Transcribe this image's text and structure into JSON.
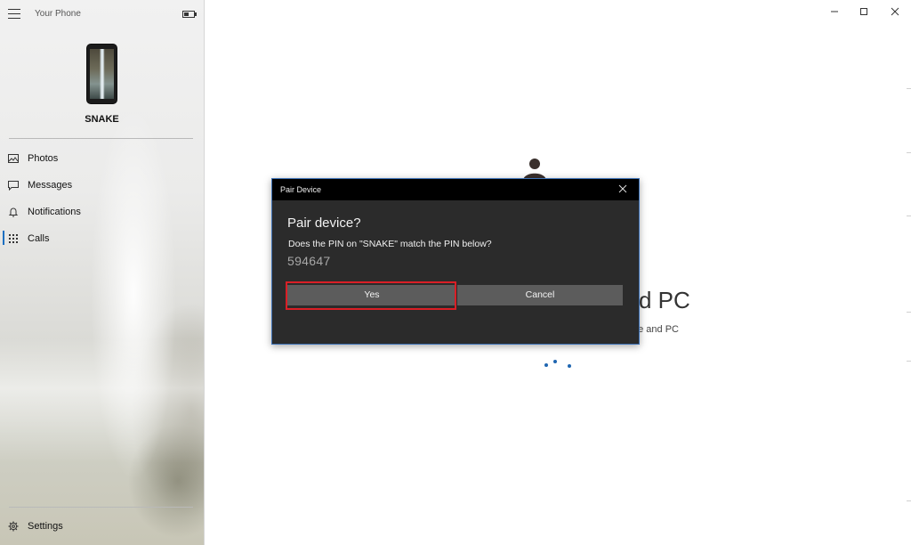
{
  "app": {
    "title": "Your Phone"
  },
  "device": {
    "name": "SNAKE"
  },
  "sidebar": {
    "items": [
      {
        "label": "Photos",
        "icon": "photos-icon"
      },
      {
        "label": "Messages",
        "icon": "message-icon"
      },
      {
        "label": "Notifications",
        "icon": "bell-icon"
      },
      {
        "label": "Calls",
        "icon": "dialpad-icon",
        "active": true
      }
    ],
    "settings_label": "Settings"
  },
  "background": {
    "heading_fragment": "d PC",
    "sub_fragment": "ne and PC"
  },
  "dialog": {
    "title": "Pair Device",
    "heading": "Pair device?",
    "question": "Does the PIN on \"SNAKE\" match the PIN below?",
    "pin": "594647",
    "yes_label": "Yes",
    "cancel_label": "Cancel"
  },
  "colors": {
    "accent": "#1c6fc1",
    "highlight": "#d91f26",
    "dialog_bg": "#2b2b2b",
    "dialog_border": "#3f73b7"
  }
}
